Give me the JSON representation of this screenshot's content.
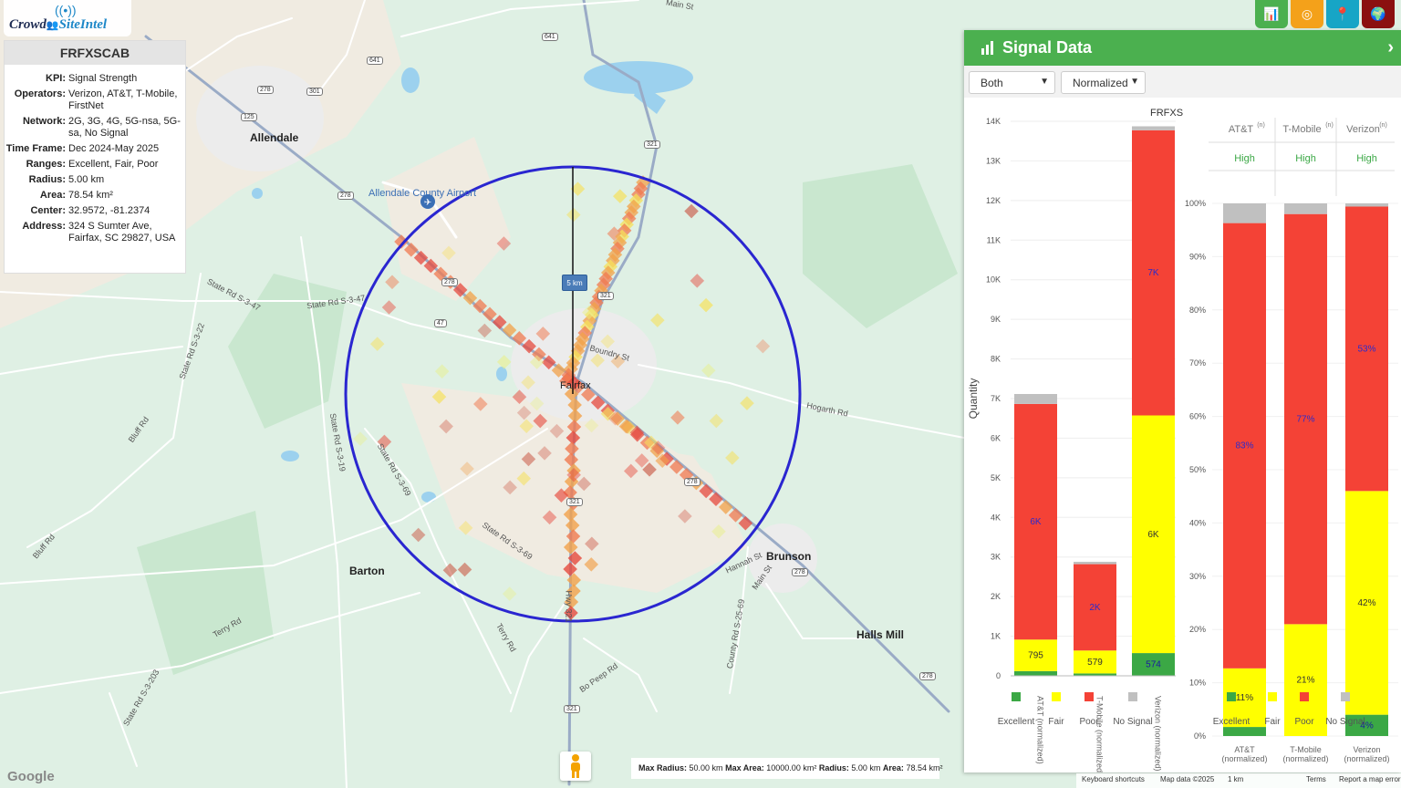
{
  "logo": {
    "part1": "Crowd",
    "part2": "SiteIntel"
  },
  "info": {
    "title": "FRFXSCAB",
    "rows": [
      {
        "k": "KPI:",
        "v": "Signal Strength"
      },
      {
        "k": "Operators:",
        "v": "Verizon, AT&T, T-Mobile, FirstNet"
      },
      {
        "k": "Network:",
        "v": "2G, 3G, 4G, 5G-nsa, 5G-sa, No Signal"
      },
      {
        "k": "Time Frame:",
        "v": "Dec 2024-May 2025"
      },
      {
        "k": "Ranges:",
        "v": "Excellent, Fair, Poor"
      },
      {
        "k": "Radius:",
        "v": "5.00 km"
      },
      {
        "k": "Area:",
        "v": "78.54 km²"
      },
      {
        "k": "Center:",
        "v": "32.9572, -81.2374"
      },
      {
        "k": "Address:",
        "v": "324 S Sumter Ave, Fairfax, SC 29827, USA"
      }
    ]
  },
  "toolbar": {
    "buttons": [
      {
        "name": "signal-data-button",
        "icon": "bar-chart-icon",
        "color": "#4bb04f",
        "glyph": "📊"
      },
      {
        "name": "target-button",
        "icon": "target-icon",
        "color": "#f4a11a",
        "glyph": "◎"
      },
      {
        "name": "location-button",
        "icon": "map-pin-icon",
        "color": "#17a5c6",
        "glyph": "📍"
      },
      {
        "name": "globe-button",
        "icon": "globe-icon",
        "color": "#8b1010",
        "glyph": "🌍"
      }
    ]
  },
  "map": {
    "labels": {
      "allendale": "Allendale",
      "airport": "Allendale County Airport",
      "fairfax": "Fairfax",
      "barton": "Barton",
      "brunson": "Brunson",
      "halls_mill": "Halls Mill",
      "state_rd_s3_47a": "State Rd S-3-47",
      "state_rd_s3_47b": "State Rd S-3-47",
      "state_rd_s3_22": "State Rd S-3-22",
      "state_rd_s3_19": "State Rd S-3-19",
      "state_rd_s3_69a": "State Rd S-3-69",
      "state_rd_s3_69b": "State Rd S-3-69",
      "state_rd_s3_203": "State Rd S-3-203",
      "bluff_rd_a": "Bluff Rd",
      "bluff_rd_b": "Bluff Rd",
      "terry_rd_a": "Terry Rd",
      "terry_rd_b": "Terry Rd",
      "boundry_st": "Boundry St",
      "hogarth_rd": "Hogarth Rd",
      "hannah_st": "Hannah St",
      "main_st": "Main St",
      "main_st_top": "Main St",
      "county_rd": "County Rd S-25-69",
      "bo_peep_rd": "Bo Peep Rd",
      "hwy_321": "Hwy 321"
    },
    "shields": [
      "641",
      "641",
      "278",
      "301",
      "125",
      "278",
      "321",
      "278",
      "278",
      "321",
      "321",
      "47",
      "278",
      "278",
      "321"
    ],
    "scale_chip": "5 km"
  },
  "panel": {
    "title": "Signal Data",
    "select_operator": "Both",
    "select_mode": "Normalized",
    "left_chart_title": "FRFXSCAB",
    "tech_labels": {
      "att": "AT&T",
      "tmo": "T-Mobile",
      "vzw": "Verizon",
      "sup": "(n)"
    },
    "tech_values": {
      "att": "High",
      "tmo": "High",
      "vzw": "High"
    }
  },
  "chart_data": [
    {
      "type": "bar",
      "title": "FRFXSCAB",
      "stacked": true,
      "categories": [
        "AT&T (normalized)",
        "T-Mobile (normalized)",
        "Verizon (normalized)"
      ],
      "ylabel": "Quantity",
      "ylim": [
        0,
        14000
      ],
      "yticks": [
        "0",
        "1K",
        "2K",
        "3K",
        "4K",
        "5K",
        "6K",
        "7K",
        "8K",
        "9K",
        "10K",
        "11K",
        "12K",
        "13K",
        "14K"
      ],
      "series": [
        {
          "name": "Excellent",
          "color": "#3ba845",
          "values": [
            120,
            60,
            574
          ],
          "labels": [
            "",
            "",
            "574"
          ]
        },
        {
          "name": "Fair",
          "color": "#ffff00",
          "values": [
            795,
            579,
            6000
          ],
          "labels": [
            "795",
            "579",
            "6K"
          ]
        },
        {
          "name": "Poor",
          "color": "#f44236",
          "values": [
            5950,
            2180,
            7200
          ],
          "labels": [
            "6K",
            "2K",
            "7K"
          ]
        },
        {
          "name": "No Signal",
          "color": "#c0c0c0",
          "values": [
            250,
            60,
            100
          ],
          "labels": [
            "",
            "",
            ""
          ]
        }
      ]
    },
    {
      "type": "bar",
      "stacked": true,
      "percent": true,
      "categories": [
        "AT&T (normalized)",
        "T-Mobile (normalized)",
        "Verizon (normalized)"
      ],
      "ylim": [
        0,
        100
      ],
      "yticks": [
        "0%",
        "10%",
        "20%",
        "30%",
        "40%",
        "50%",
        "60%",
        "70%",
        "80%",
        "90%",
        "100%"
      ],
      "series": [
        {
          "name": "Excellent",
          "color": "#3ba845",
          "values": [
            1.7,
            0,
            4
          ],
          "labels": [
            "",
            "",
            "4%"
          ]
        },
        {
          "name": "Fair",
          "color": "#ffff00",
          "values": [
            11,
            21,
            42
          ],
          "labels": [
            "11%",
            "21%",
            "42%"
          ]
        },
        {
          "name": "Poor",
          "color": "#f44236",
          "values": [
            83.6,
            77,
            53.4
          ],
          "labels": [
            "83%",
            "77%",
            "53%"
          ]
        },
        {
          "name": "No Signal",
          "color": "#c0c0c0",
          "values": [
            3.7,
            2,
            0.6
          ],
          "labels": [
            "",
            "",
            ""
          ]
        }
      ]
    }
  ],
  "legend": [
    "Excellent",
    "Fair",
    "Poor",
    "No Signal"
  ],
  "bottom": {
    "radius_info": {
      "k1": "Max Radius:",
      "v1": "50.00 km",
      "k2": "Max Area:",
      "v2": "10000.00 km²",
      "k3": "Radius:",
      "v3": "5.00 km",
      "k4": "Area:",
      "v4": "78.54 km²"
    },
    "google": "Google",
    "attrib": {
      "shortcuts": "Keyboard shortcuts",
      "mapdata": "Map data ©2025",
      "scale": "1 km",
      "terms": "Terms",
      "report": "Report a map error"
    }
  }
}
